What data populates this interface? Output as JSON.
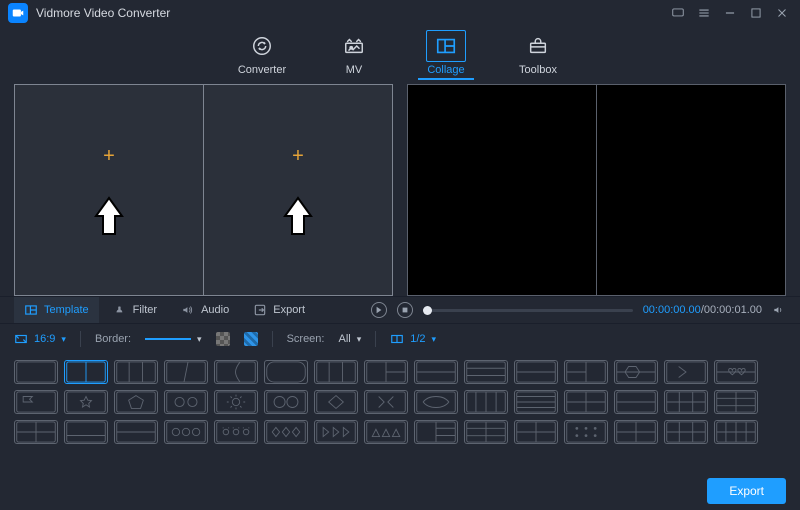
{
  "app": {
    "title": "Vidmore Video Converter"
  },
  "nav": {
    "items": [
      {
        "label": "Converter"
      },
      {
        "label": "MV"
      },
      {
        "label": "Collage"
      },
      {
        "label": "Toolbox"
      }
    ]
  },
  "tabs": {
    "template": "Template",
    "filter": "Filter",
    "audio": "Audio",
    "export": "Export"
  },
  "player": {
    "current": "00:00:00.00",
    "separator": "/",
    "total": "00:00:01.00"
  },
  "options": {
    "ratio_label": "16:9",
    "border_label": "Border:",
    "screen_label": "Screen:",
    "screen_value": "All",
    "split_value": "1/2"
  },
  "footer": {
    "export": "Export"
  }
}
